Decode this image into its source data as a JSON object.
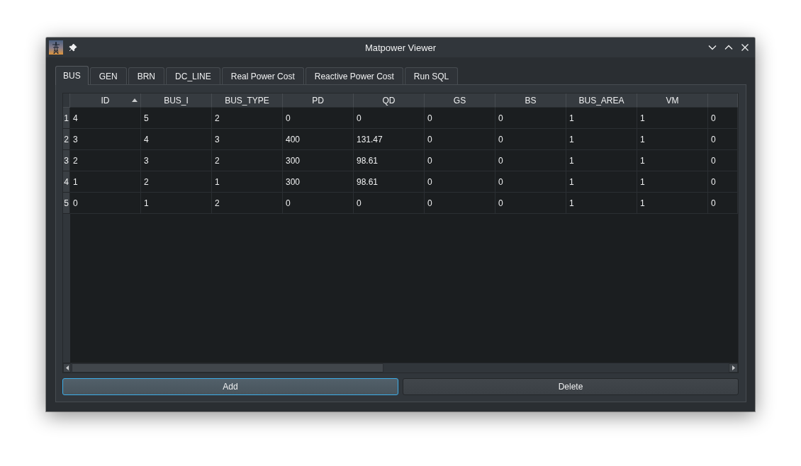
{
  "window": {
    "title": "Matpower Viewer"
  },
  "tabs": [
    {
      "label": "BUS",
      "selected": true
    },
    {
      "label": "GEN",
      "selected": false
    },
    {
      "label": "BRN",
      "selected": false
    },
    {
      "label": "DC_LINE",
      "selected": false
    },
    {
      "label": "Real Power Cost",
      "selected": false
    },
    {
      "label": "Reactive Power Cost",
      "selected": false
    },
    {
      "label": "Run SQL",
      "selected": false
    }
  ],
  "table": {
    "columns": [
      {
        "label": "ID",
        "sorted": true
      },
      {
        "label": "BUS_I",
        "sorted": false
      },
      {
        "label": "BUS_TYPE",
        "sorted": false
      },
      {
        "label": "PD",
        "sorted": false
      },
      {
        "label": "QD",
        "sorted": false
      },
      {
        "label": "GS",
        "sorted": false
      },
      {
        "label": "BS",
        "sorted": false
      },
      {
        "label": "BUS_AREA",
        "sorted": false
      },
      {
        "label": "VM",
        "sorted": false
      }
    ],
    "rows": [
      {
        "header": "1",
        "cells": [
          "4",
          "5",
          "2",
          "0",
          "0",
          "0",
          "0",
          "1",
          "1",
          "0"
        ]
      },
      {
        "header": "2",
        "cells": [
          "3",
          "4",
          "3",
          "400",
          "131.47",
          "0",
          "0",
          "1",
          "1",
          "0"
        ]
      },
      {
        "header": "3",
        "cells": [
          "2",
          "3",
          "2",
          "300",
          "98.61",
          "0",
          "0",
          "1",
          "1",
          "0"
        ]
      },
      {
        "header": "4",
        "cells": [
          "1",
          "2",
          "1",
          "300",
          "98.61",
          "0",
          "0",
          "1",
          "1",
          "0"
        ]
      },
      {
        "header": "5",
        "cells": [
          "0",
          "1",
          "2",
          "0",
          "0",
          "0",
          "0",
          "1",
          "1",
          "0"
        ]
      }
    ]
  },
  "buttons": [
    {
      "label": "Add",
      "focused": true
    },
    {
      "label": "Delete",
      "focused": false
    }
  ]
}
